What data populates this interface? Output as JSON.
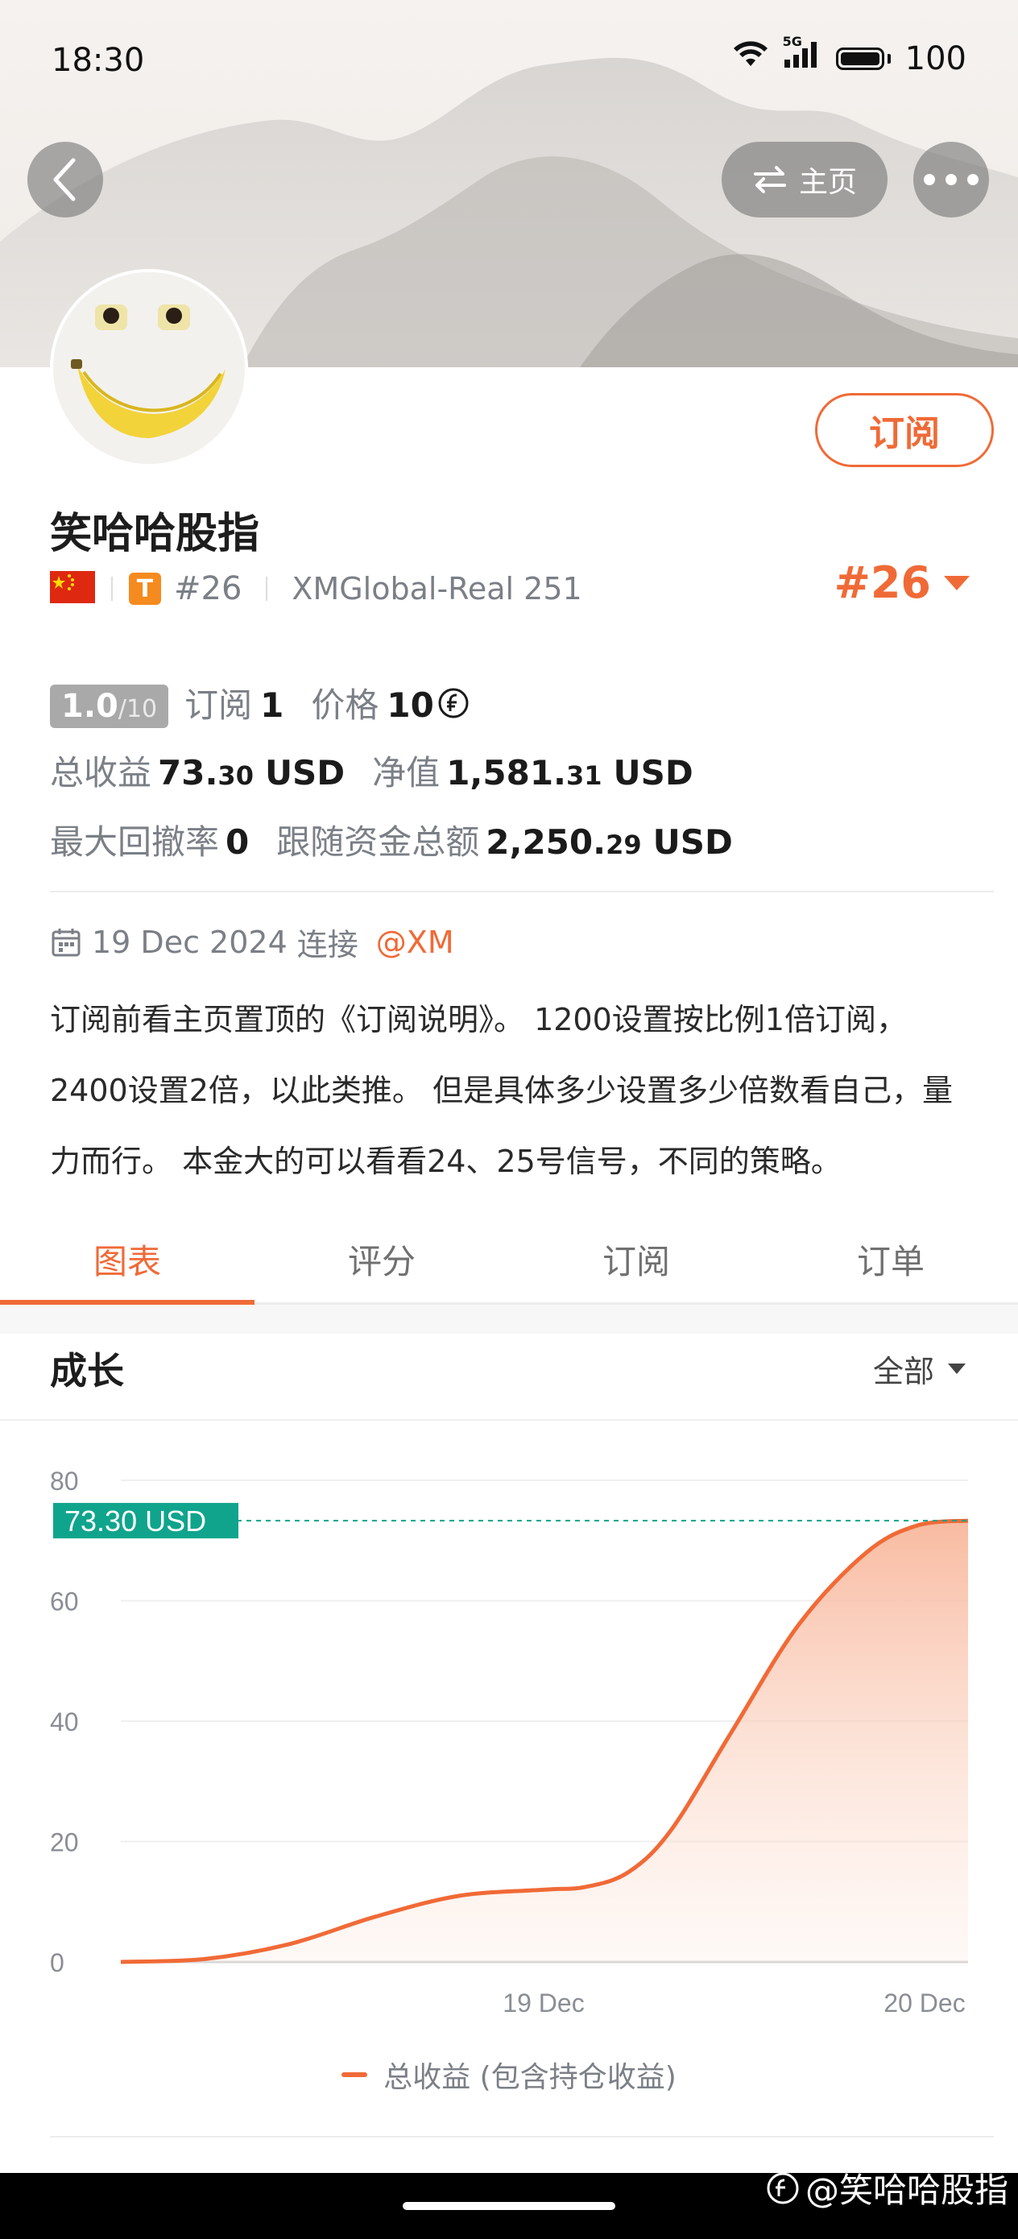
{
  "status_bar": {
    "time": "18:30",
    "network": "5G",
    "battery": "100"
  },
  "nav": {
    "home_label": "主页"
  },
  "profile": {
    "name": "笑哈哈股指",
    "rank_badge": "T",
    "rank_text": "#26",
    "account": "XMGlobal-Real 251",
    "rank_right": "#26",
    "subscribe_label": "订阅"
  },
  "stats": {
    "score_main": "1.0",
    "score_total": "/10",
    "subs_label": "订阅",
    "subs_value": "1",
    "price_label": "价格",
    "price_value": "10",
    "price_icon": "coin-icon",
    "total_profit_label": "总收益",
    "total_profit_int": "73.",
    "total_profit_dec": "30",
    "total_profit_unit": "USD",
    "net_label": "净值",
    "net_int": "1,581.",
    "net_dec": "31",
    "net_unit": "USD",
    "drawdown_label": "最大回撤率",
    "drawdown_value": "0",
    "follow_label": "跟随资金总额",
    "follow_int": "2,250.",
    "follow_dec": "29",
    "follow_unit": "USD"
  },
  "connection": {
    "date": "19 Dec 2024",
    "label": "连接",
    "broker": "@XM"
  },
  "description": "订阅前看主页置顶的《订阅说明》。 1200设置按比例1倍订阅，2400设置2倍，以此类推。 但是具体多少设置多少倍数看自己，量力而行。 本金大的可以看看24、25号信号，不同的策略。",
  "tabs": [
    {
      "label": "图表",
      "active": true
    },
    {
      "label": "评分",
      "active": false
    },
    {
      "label": "订阅",
      "active": false
    },
    {
      "label": "订单",
      "active": false
    }
  ],
  "growth": {
    "title": "成长",
    "filter": "全部"
  },
  "chart_data": {
    "type": "area",
    "yticks": [
      "80",
      "60",
      "40",
      "20",
      "0"
    ],
    "ylim": [
      0,
      80
    ],
    "xtick_labels": [
      "19 Dec",
      "20 Dec"
    ],
    "current_value_label": "73.30 USD",
    "current_value": 73.3,
    "series": [
      {
        "name": "总收益 (包含持仓收益)",
        "points": [
          [
            0,
            0
          ],
          [
            0.1,
            0.5
          ],
          [
            0.2,
            3
          ],
          [
            0.3,
            7.5
          ],
          [
            0.4,
            11
          ],
          [
            0.5,
            12
          ],
          [
            0.55,
            12.5
          ],
          [
            0.6,
            15
          ],
          [
            0.65,
            22
          ],
          [
            0.72,
            38
          ],
          [
            0.8,
            56
          ],
          [
            0.88,
            68
          ],
          [
            0.94,
            72.5
          ],
          [
            1.0,
            73.3
          ]
        ]
      }
    ],
    "colors": {
      "line": "#f06a37",
      "fill": "#f8b79c",
      "label_bg": "#10a48c"
    },
    "grid": true
  },
  "legend": {
    "label": "总收益 (包含持仓收益)"
  },
  "watermark": "@笑哈哈股指"
}
